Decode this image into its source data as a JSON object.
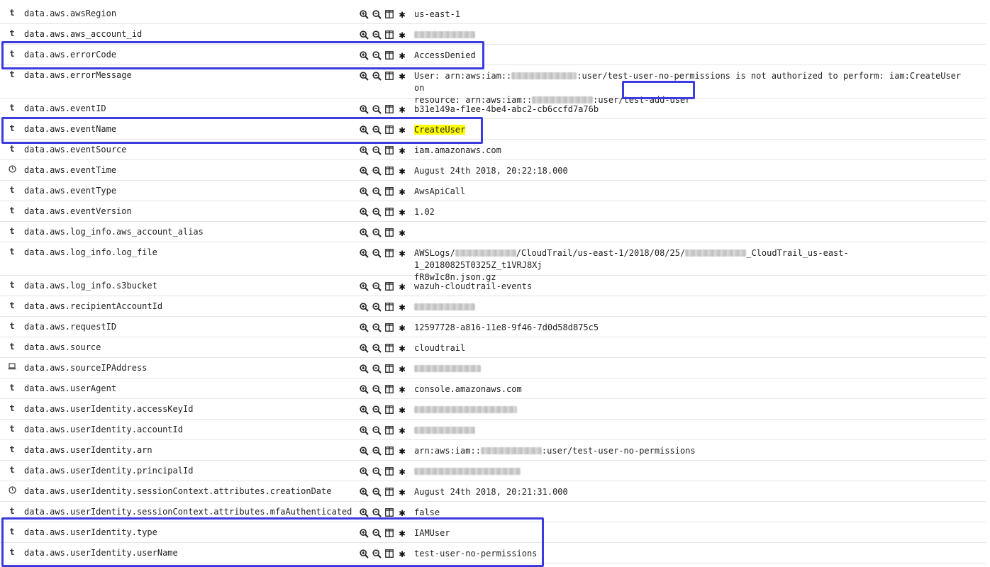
{
  "fields": [
    {
      "type": "t",
      "name": "data.aws.awsRegion",
      "value": "us-east-1"
    },
    {
      "type": "t",
      "name": "data.aws.aws_account_id",
      "value": ""
    },
    {
      "type": "t",
      "name": "data.aws.errorCode",
      "value": "AccessDenied"
    },
    {
      "type": "t",
      "name": "data.aws.errorMessage",
      "value_line1": "User: arn:aws:iam::",
      "value_line1_b": ":user/test-user-no-permissions is not authorized to perform: iam:CreateUser on",
      "value_line2_a": "resource: arn:aws:iam::",
      "value_line2_b": ":user/",
      "value_line2_c": "test-add-user"
    },
    {
      "type": "t",
      "name": "data.aws.eventID",
      "value": "b31e149a-f1ee-4be4-abc2-cb6ccfd7a76b"
    },
    {
      "type": "t",
      "name": "data.aws.eventName",
      "value": "CreateUser"
    },
    {
      "type": "t",
      "name": "data.aws.eventSource",
      "value": "iam.amazonaws.com"
    },
    {
      "type": "clock",
      "name": "data.aws.eventTime",
      "value": "August 24th 2018, 20:22:18.000"
    },
    {
      "type": "t",
      "name": "data.aws.eventType",
      "value": "AwsApiCall"
    },
    {
      "type": "t",
      "name": "data.aws.eventVersion",
      "value": "1.02"
    },
    {
      "type": "t",
      "name": "data.aws.log_info.aws_account_alias",
      "value": ""
    },
    {
      "type": "t",
      "name": "data.aws.log_info.log_file",
      "value_a": "AWSLogs/",
      "value_b": "/CloudTrail/us-east-1/2018/08/25/",
      "value_c": "_CloudTrail_us-east-1_20180825T0325Z_t1VRJ8Xj",
      "value_line2": "fR8wIc8n.json.gz"
    },
    {
      "type": "t",
      "name": "data.aws.log_info.s3bucket",
      "value": "wazuh-cloudtrail-events"
    },
    {
      "type": "t",
      "name": "data.aws.recipientAccountId",
      "value": ""
    },
    {
      "type": "t",
      "name": "data.aws.requestID",
      "value": "12597728-a816-11e8-9f46-7d0d58d875c5"
    },
    {
      "type": "t",
      "name": "data.aws.source",
      "value": "cloudtrail"
    },
    {
      "type": "laptop",
      "name": "data.aws.sourceIPAddress",
      "value": ""
    },
    {
      "type": "t",
      "name": "data.aws.userAgent",
      "value": "console.amazonaws.com"
    },
    {
      "type": "t",
      "name": "data.aws.userIdentity.accessKeyId",
      "value": ""
    },
    {
      "type": "t",
      "name": "data.aws.userIdentity.accountId",
      "value": ""
    },
    {
      "type": "t",
      "name": "data.aws.userIdentity.arn",
      "value_a": "arn:aws:iam::",
      "value_b": ":user/test-user-no-permissions"
    },
    {
      "type": "t",
      "name": "data.aws.userIdentity.principalId",
      "value": ""
    },
    {
      "type": "clock",
      "name": "data.aws.userIdentity.sessionContext.attributes.creationDate",
      "value": "August 24th 2018, 20:21:31.000"
    },
    {
      "type": "t",
      "name": "data.aws.userIdentity.sessionContext.attributes.mfaAuthenticated",
      "value": "false"
    },
    {
      "type": "t",
      "name": "data.aws.userIdentity.type",
      "value": "IAMUser"
    },
    {
      "type": "t",
      "name": "data.aws.userIdentity.userName",
      "value": "test-user-no-permissions"
    }
  ],
  "icons": {
    "filter_for": "zoom-in-icon",
    "filter_out": "zoom-out-icon",
    "toggle_column": "column-icon",
    "exists": "asterisk-icon",
    "string_type": "t",
    "date_type": "clock-icon",
    "ip_type": "laptop-icon"
  },
  "colors": {
    "highlight": "#ffff00",
    "annotation_box": "#3b3be0"
  }
}
